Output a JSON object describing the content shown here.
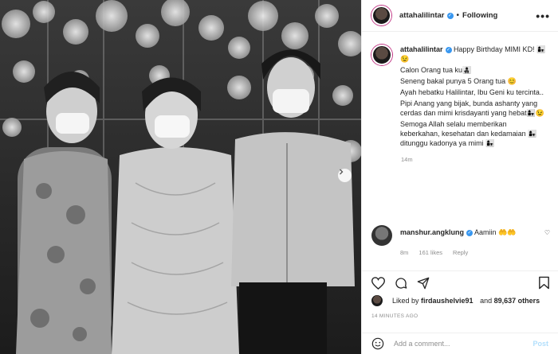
{
  "header": {
    "username": "attahalilintar",
    "separator": "•",
    "follow_status": "Following",
    "more": "•••"
  },
  "caption": {
    "username": "attahalilintar",
    "lines": [
      "Happy Birthday MIMI KD! 👩‍👧😉",
      "Calon Orang tua ku👩‍👧‍👦",
      "Seneng bakal punya 5 Orang tua 😊",
      "Ayah hebatku Halilintar, Ibu Geni ku tercinta..",
      "Pipi Anang yang bijak, bunda ashanty yang cerdas dan mimi krisdayanti yang hebat👩‍👧😉",
      "Semoga Allah selalu memberikan keberkahan, kesehatan dan kedamaian 👩‍👧 ditunggu kadonya ya mimi 👩‍👧"
    ],
    "time": "14m"
  },
  "comment": {
    "username": "manshur.angklung",
    "text": "Aamiin 🤲🤲",
    "time": "8m",
    "likes": "161 likes",
    "reply": "Reply"
  },
  "likes_line": {
    "prefix": "Liked by ",
    "user": "firdaushelvie91",
    "middle": " and ",
    "count": "89,637 others"
  },
  "time_ago": "14 MINUTES AGO",
  "add_comment": {
    "placeholder": "Add a comment...",
    "post_label": "Post"
  },
  "colors": {
    "verified": "#3897f0",
    "muted": "#8e8e8e",
    "post_disabled": "#b2dffc"
  }
}
